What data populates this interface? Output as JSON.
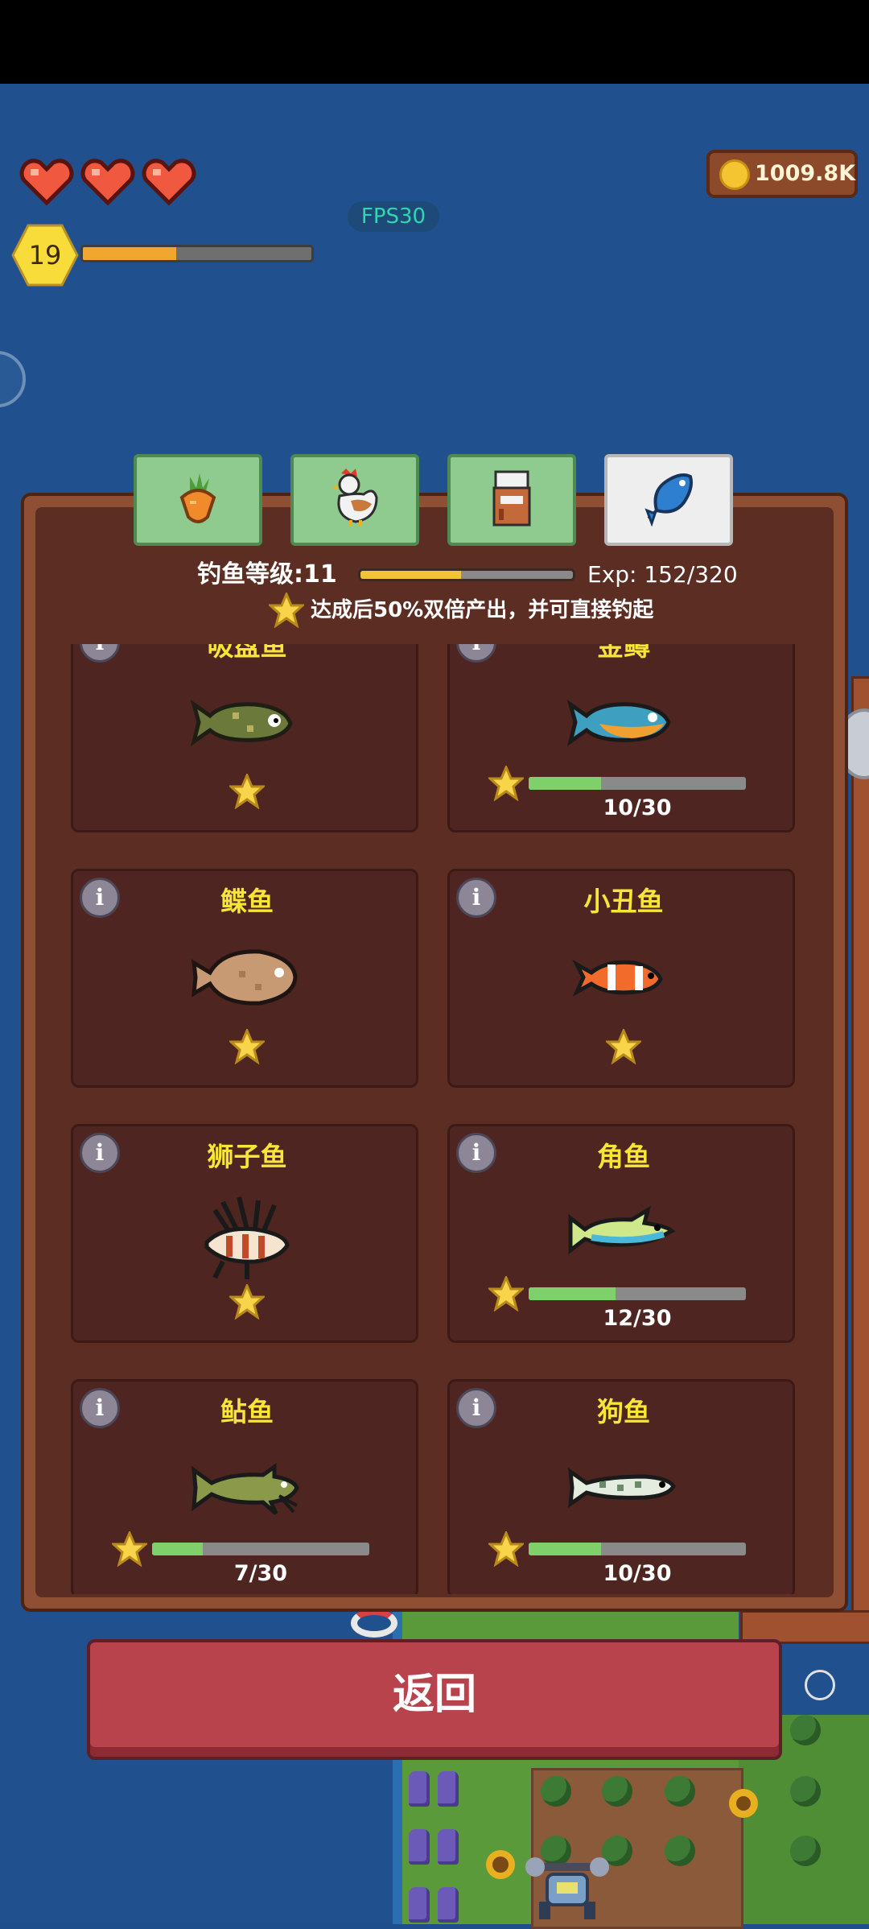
{
  "hud": {
    "hearts": [
      "heart",
      "heart",
      "heart"
    ],
    "level": "19",
    "xp_progress": 0.41,
    "fps": "FPS30",
    "coins": "1009.8K"
  },
  "tabs": [
    {
      "icon": "carrot-icon",
      "active": false
    },
    {
      "icon": "chicken-icon",
      "active": false
    },
    {
      "icon": "jar-icon",
      "active": false
    },
    {
      "icon": "fish-icon",
      "active": true
    }
  ],
  "panel": {
    "fishing_level": "钓鱼等级:11",
    "level_progress": 0.475,
    "exp": "Exp: 152/320",
    "hint": "达成后50%双倍产出，并可直接钓起"
  },
  "fish_cards": [
    {
      "name": "吸盘鱼",
      "info": "i",
      "progress_text": null,
      "progress": null
    },
    {
      "name": "金鳟",
      "info": "i",
      "progress_text": "10/30",
      "progress": 0.333
    },
    {
      "name": "鲽鱼",
      "info": "i",
      "progress_text": null,
      "progress": null
    },
    {
      "name": "小丑鱼",
      "info": "i",
      "progress_text": null,
      "progress": null
    },
    {
      "name": "狮子鱼",
      "info": "i",
      "progress_text": null,
      "progress": null
    },
    {
      "name": "角鱼",
      "info": "i",
      "progress_text": "12/30",
      "progress": 0.4
    },
    {
      "name": "鲇鱼",
      "info": "i",
      "progress_text": "7/30",
      "progress": 0.233
    },
    {
      "name": "狗鱼",
      "info": "i",
      "progress_text": "10/30",
      "progress": 0.333
    }
  ],
  "back_button": "返回",
  "colors": {
    "panel": "#8e4f35",
    "card": "#4e2520",
    "name_yellow": "#f7e537",
    "progress_green": "#7fd06a",
    "back_red": "#b8434c"
  }
}
